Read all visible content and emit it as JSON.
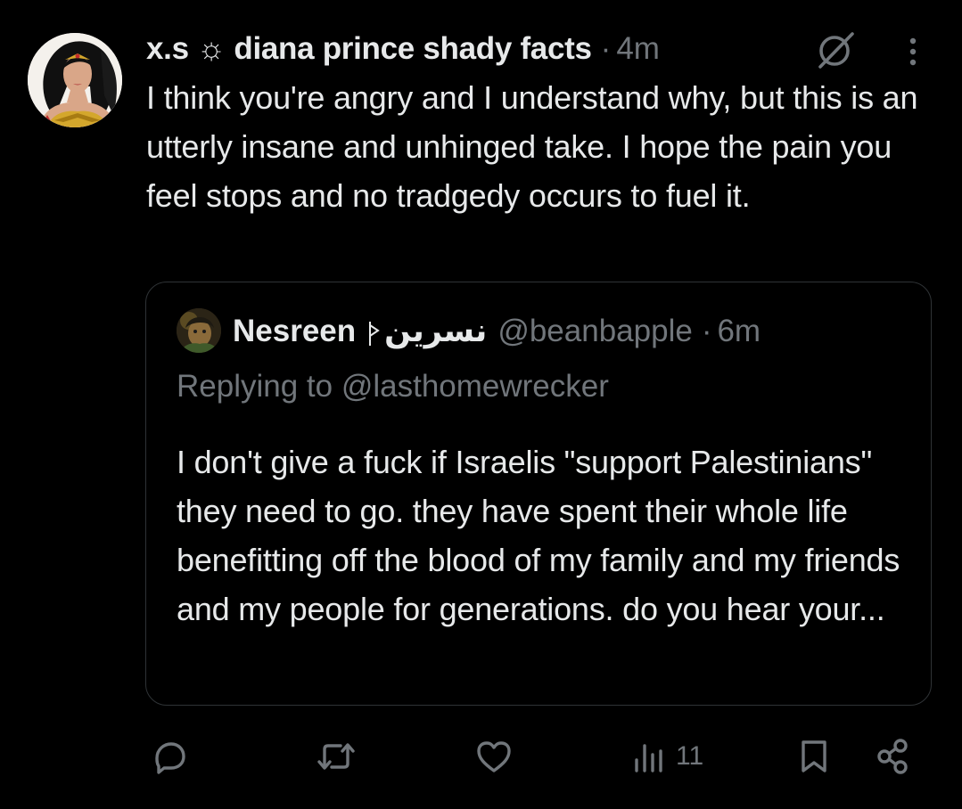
{
  "tweet": {
    "author_name": "x.s ☼ diana prince shady facts",
    "separator": "·",
    "timestamp": "4m",
    "text": "I think you're angry and I understand why, but this is an utterly insane and unhinged take. I hope the pain you feel stops and no tradgedy occurs to fuel it."
  },
  "quoted_tweet": {
    "author_name": "Nesreen",
    "author_arabic_name": "نسرين",
    "handle": "@beanbapple",
    "separator": "·",
    "timestamp": "6m",
    "replying_to": "Replying to @lasthomewrecker",
    "text": "I don't give a fuck if Israelis \"support Palestinians\" they need to go. they have spent their whole life benefitting off the blood of my family and my friends and my people for generations. do you hear your..."
  },
  "actions": {
    "reply_icon": "speech-bubble-icon",
    "retweet_icon": "retweet-icon",
    "like_icon": "heart-icon",
    "views_icon": "bar-chart-icon",
    "views_count": "11",
    "bookmark_icon": "bookmark-icon",
    "share_icon": "share-icon"
  },
  "colors": {
    "background": "#000000",
    "text_primary": "#e7e9ea",
    "text_secondary": "#71767b",
    "border": "#2f3336"
  }
}
